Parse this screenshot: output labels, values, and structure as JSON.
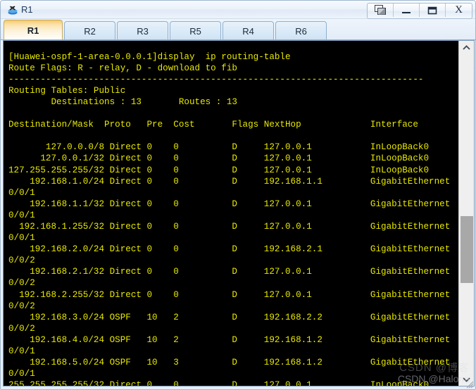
{
  "window": {
    "title": "R1",
    "icon": "router-icon",
    "buttons": [
      {
        "name": "restore-cascade-button",
        "label": ""
      },
      {
        "name": "minimize-button",
        "label": ""
      },
      {
        "name": "maximize-button",
        "label": ""
      },
      {
        "name": "close-button",
        "label": "X"
      }
    ]
  },
  "tabs": {
    "active_index": 0,
    "items": [
      {
        "label": "R1"
      },
      {
        "label": "R2"
      },
      {
        "label": "R3"
      },
      {
        "label": "R5"
      },
      {
        "label": "R4"
      },
      {
        "label": "R6"
      }
    ]
  },
  "terminal": {
    "colors": {
      "background": "#000000",
      "foreground": "#e8e800"
    },
    "prompt": "[Huawei-ospf-1-area-0.0.0.1]",
    "command": "display  ip routing-table",
    "route_flags_line": "Route Flags: R - relay, D - download to fib",
    "separator": "------------------------------------------------------------------------------",
    "routing_table_label": "Routing Tables: Public",
    "destinations_label": "Destinations",
    "destinations_count": "13",
    "routes_label": "Routes",
    "routes_count": "13",
    "columns": [
      "Destination/Mask",
      "Proto",
      "Pre",
      "Cost",
      "Flags",
      "NextHop",
      "Interface"
    ],
    "rows": [
      {
        "dest": "127.0.0.0/8",
        "proto": "Direct",
        "pre": "0",
        "cost": "0",
        "flags": "D",
        "nexthop": "127.0.0.1",
        "interface": "InLoopBack0",
        "interface_wrap": ""
      },
      {
        "dest": "127.0.0.1/32",
        "proto": "Direct",
        "pre": "0",
        "cost": "0",
        "flags": "D",
        "nexthop": "127.0.0.1",
        "interface": "InLoopBack0",
        "interface_wrap": ""
      },
      {
        "dest": "127.255.255.255/32",
        "proto": "Direct",
        "pre": "0",
        "cost": "0",
        "flags": "D",
        "nexthop": "127.0.0.1",
        "interface": "InLoopBack0",
        "interface_wrap": ""
      },
      {
        "dest": "192.168.1.0/24",
        "proto": "Direct",
        "pre": "0",
        "cost": "0",
        "flags": "D",
        "nexthop": "192.168.1.1",
        "interface": "GigabitEthernet",
        "interface_wrap": "0/0/1"
      },
      {
        "dest": "192.168.1.1/32",
        "proto": "Direct",
        "pre": "0",
        "cost": "0",
        "flags": "D",
        "nexthop": "127.0.0.1",
        "interface": "GigabitEthernet",
        "interface_wrap": "0/0/1"
      },
      {
        "dest": "192.168.1.255/32",
        "proto": "Direct",
        "pre": "0",
        "cost": "0",
        "flags": "D",
        "nexthop": "127.0.0.1",
        "interface": "GigabitEthernet",
        "interface_wrap": "0/0/1"
      },
      {
        "dest": "192.168.2.0/24",
        "proto": "Direct",
        "pre": "0",
        "cost": "0",
        "flags": "D",
        "nexthop": "192.168.2.1",
        "interface": "GigabitEthernet",
        "interface_wrap": "0/0/2"
      },
      {
        "dest": "192.168.2.1/32",
        "proto": "Direct",
        "pre": "0",
        "cost": "0",
        "flags": "D",
        "nexthop": "127.0.0.1",
        "interface": "GigabitEthernet",
        "interface_wrap": "0/0/2"
      },
      {
        "dest": "192.168.2.255/32",
        "proto": "Direct",
        "pre": "0",
        "cost": "0",
        "flags": "D",
        "nexthop": "127.0.0.1",
        "interface": "GigabitEthernet",
        "interface_wrap": "0/0/2"
      },
      {
        "dest": "192.168.3.0/24",
        "proto": "OSPF",
        "pre": "10",
        "cost": "2",
        "flags": "D",
        "nexthop": "192.168.2.2",
        "interface": "GigabitEthernet",
        "interface_wrap": "0/0/2"
      },
      {
        "dest": "192.168.4.0/24",
        "proto": "OSPF",
        "pre": "10",
        "cost": "2",
        "flags": "D",
        "nexthop": "192.168.1.2",
        "interface": "GigabitEthernet",
        "interface_wrap": "0/0/1"
      },
      {
        "dest": "192.168.5.0/24",
        "proto": "OSPF",
        "pre": "10",
        "cost": "3",
        "flags": "D",
        "nexthop": "192.168.1.2",
        "interface": "GigabitEthernet",
        "interface_wrap": "0/0/1"
      },
      {
        "dest": "255.255.255.255/32",
        "proto": "Direct",
        "pre": "0",
        "cost": "0",
        "flags": "D",
        "nexthop": "127.0.0.1",
        "interface": "InLoopBack0",
        "interface_wrap": ""
      }
    ]
  },
  "scrollbar": {
    "up_arrow": "chevron-up-icon",
    "down_arrow": "chevron-down-icon"
  },
  "watermark": {
    "cjk": "CSDN @博客",
    "text": "CSDN @Halona"
  }
}
